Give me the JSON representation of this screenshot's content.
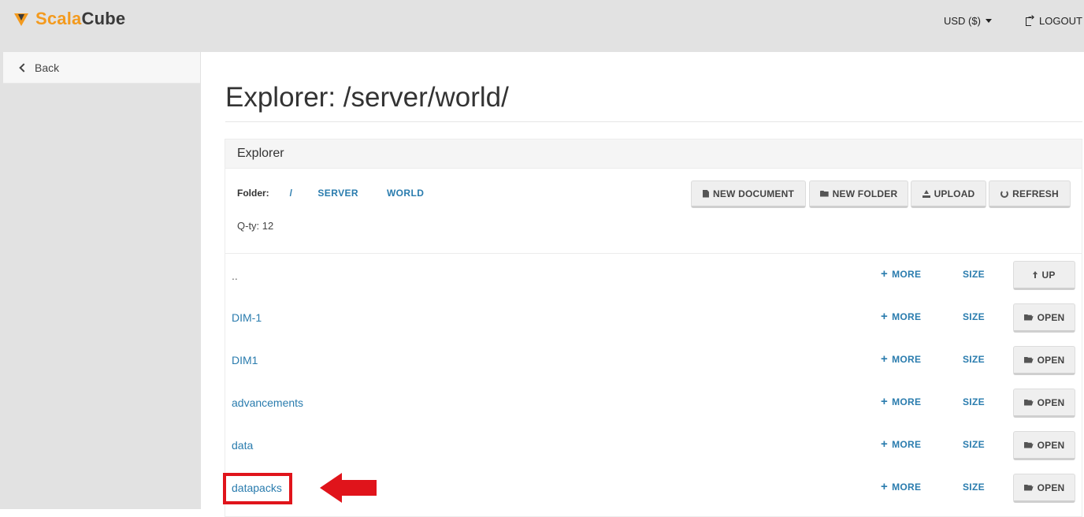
{
  "brand": {
    "part1": "Scala",
    "part2": "Cube",
    "accent": "#f39a1e"
  },
  "header": {
    "currency": "USD ($)",
    "logout": "LOGOUT"
  },
  "sidebar": {
    "back": "Back"
  },
  "page": {
    "title": "Explorer: /server/world/"
  },
  "panel": {
    "heading": "Explorer",
    "folder_label": "Folder:",
    "breadcrumbs": [
      "/",
      "SERVER",
      "WORLD"
    ],
    "qty": "Q-ty: 12",
    "actions": {
      "new_document": "NEW DOCUMENT",
      "new_folder": "NEW FOLDER",
      "upload": "UPLOAD",
      "refresh": "REFRESH"
    }
  },
  "files": [
    {
      "name": "..",
      "more": "MORE",
      "size": "SIZE",
      "action": "UP"
    },
    {
      "name": "DIM-1",
      "more": "MORE",
      "size": "SIZE",
      "action": "OPEN"
    },
    {
      "name": "DIM1",
      "more": "MORE",
      "size": "SIZE",
      "action": "OPEN"
    },
    {
      "name": "advancements",
      "more": "MORE",
      "size": "SIZE",
      "action": "OPEN"
    },
    {
      "name": "data",
      "more": "MORE",
      "size": "SIZE",
      "action": "OPEN"
    },
    {
      "name": "datapacks",
      "more": "MORE",
      "size": "SIZE",
      "action": "OPEN"
    }
  ],
  "annotation": {
    "color": "#e0141b",
    "target": "datapacks"
  }
}
